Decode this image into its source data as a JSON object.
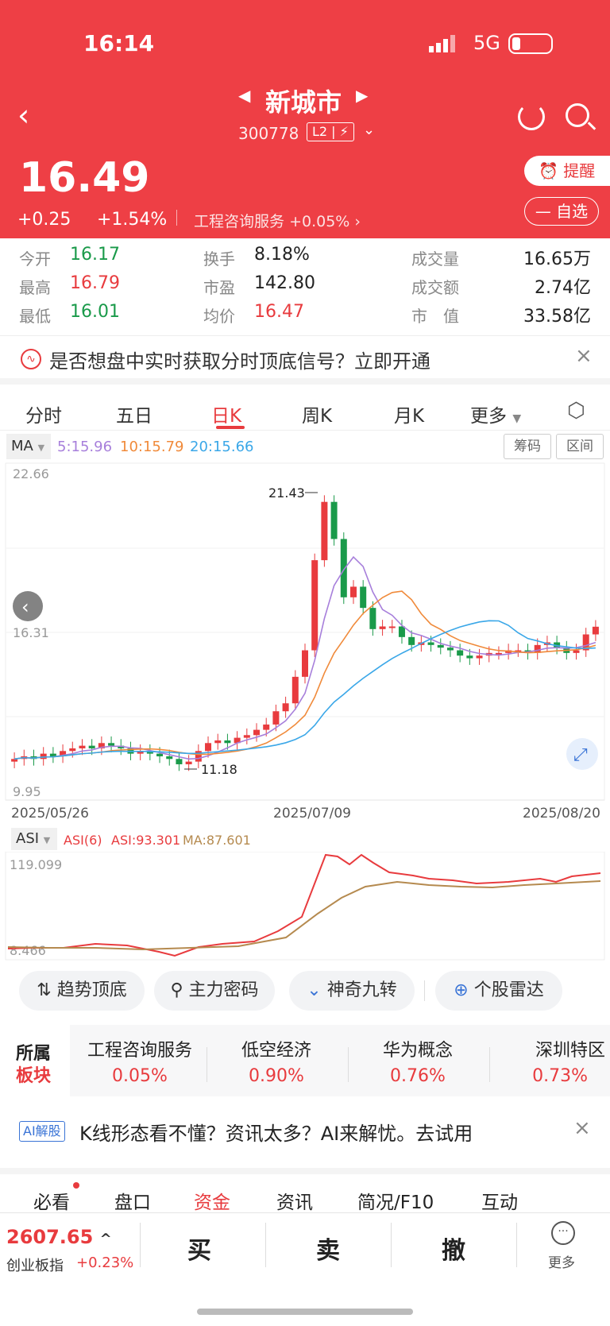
{
  "status": {
    "time": "16:14",
    "network": "5G"
  },
  "stock": {
    "name": "新城市",
    "code": "300778",
    "level": "L2",
    "price": "16.49",
    "change": "+0.25",
    "change_pct": "+1.54%",
    "industry": "工程咨询服务",
    "industry_pct": "+0.05%"
  },
  "header_buttons": {
    "alert": "提醒",
    "watch": "自选"
  },
  "stats": [
    {
      "label": "今开",
      "value": "16.17",
      "color": "#1a9a4a"
    },
    {
      "label": "最高",
      "value": "16.79",
      "color": "#e83b3e"
    },
    {
      "label": "最低",
      "value": "16.01",
      "color": "#1a9a4a"
    },
    {
      "label": "换手",
      "value": "8.18%",
      "color": "#222"
    },
    {
      "label": "市盈",
      "value": "142.80",
      "color": "#222"
    },
    {
      "label": "均价",
      "value": "16.47",
      "color": "#e83b3e"
    },
    {
      "label": "成交量",
      "value": "16.65万",
      "color": "#222"
    },
    {
      "label": "成交额",
      "value": "2.74亿",
      "color": "#222"
    },
    {
      "label": "市　值",
      "value": "33.58亿",
      "color": "#222"
    }
  ],
  "banner": {
    "text": "是否想盘中实时获取分时顶底信号？立即开通"
  },
  "chart_tabs": [
    "分时",
    "五日",
    "日K",
    "周K",
    "月K",
    "更多"
  ],
  "active_tab": "日K",
  "chart": {
    "ma_label": "MA",
    "ma5": "5:15.96",
    "ma10": "10:15.79",
    "ma20": "20:15.66",
    "btn_chip": "筹码",
    "btn_range": "区间",
    "y_top": "22.66",
    "y_mid": "16.31",
    "y_low": "9.95",
    "high_label": "21.43",
    "low_label": "11.18",
    "dates": [
      "2025/05/26",
      "2025/07/09",
      "2025/08/20"
    ],
    "asi_label": "ASI",
    "asi_param": "ASI(6)",
    "asi_value": "ASI:93.301",
    "asi_ma": "MA:87.601",
    "asi_top": "119.099",
    "asi_bottom": "8.466"
  },
  "chart_data": {
    "type": "candlestick",
    "ylim": [
      9.95,
      22.66
    ],
    "series": [
      {
        "name": "MA5",
        "value": 15.96
      },
      {
        "name": "MA10",
        "value": 15.79
      },
      {
        "name": "MA20",
        "value": 15.66
      }
    ]
  },
  "tools": [
    "趋势顶底",
    "主力密码",
    "神奇九转",
    "个股雷达"
  ],
  "sectors": {
    "title1": "所属",
    "title2": "板块",
    "items": [
      {
        "name": "工程咨询服务",
        "pct": "0.05%"
      },
      {
        "name": "低空经济",
        "pct": "0.90%"
      },
      {
        "name": "华为概念",
        "pct": "0.76%"
      },
      {
        "name": "深圳特区",
        "pct": "0.73%"
      }
    ]
  },
  "ai": {
    "badge": "AI解股",
    "text": "K线形态看不懂？资讯太多？AI来解忧。去试用"
  },
  "bottom_tabs": [
    "必看",
    "盘口",
    "资金",
    "资讯",
    "简况/F10",
    "互动"
  ],
  "index": {
    "value": "2607.65",
    "name": "创业板指",
    "pct": "+0.23%"
  },
  "actions": {
    "buy": "买",
    "sell": "卖",
    "cancel": "撤",
    "more": "更多"
  }
}
